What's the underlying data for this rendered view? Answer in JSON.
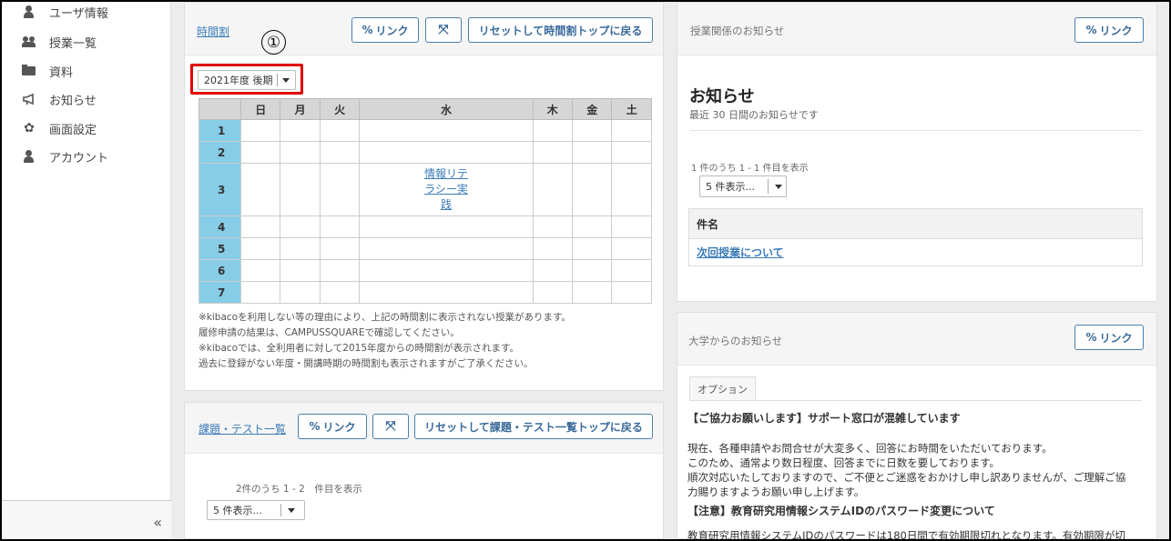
{
  "sidebar": {
    "items": [
      {
        "label": "ユーザ情報",
        "icon": "user-icon"
      },
      {
        "label": "授業一覧",
        "icon": "people-icon"
      },
      {
        "label": "資料",
        "icon": "folder-icon"
      },
      {
        "label": "お知らせ",
        "icon": "megaphone-icon"
      },
      {
        "label": "画面設定",
        "icon": "gear-icon"
      },
      {
        "label": "アカウント",
        "icon": "user-icon"
      }
    ],
    "collapse": "«"
  },
  "timetable": {
    "title": "時間割",
    "link_btn": "リンク",
    "expand_btn": "⤧",
    "reset_btn": "リセットして時間割トップに戻る",
    "term_select": "2021年度 後期",
    "annotation": "①",
    "days": [
      "日",
      "月",
      "火",
      "水",
      "木",
      "金",
      "土"
    ],
    "periods": [
      "1",
      "2",
      "3",
      "4",
      "5",
      "6",
      "7"
    ],
    "course": "情報リテラシー実践",
    "notes": [
      "※kibacoを利用しない等の理由により、上記の時間割に表示されない授業があります。",
      "履修申請の結果は、CAMPUSSQUAREで確認してください。",
      "※kibacoでは、全利用者に対して2015年度からの時間割が表示されます。",
      "過去に登録がない年度・開講時期の時間割も表示されますがご了承ください。"
    ]
  },
  "assignments": {
    "title": "課題・テスト一覧",
    "link_btn": "リンク",
    "expand_btn": "⤧",
    "reset_btn": "リセットして課題・テスト一覧トップに戻る",
    "count_text": "2件のうち 1 - 2　件目を表示",
    "page_select": "5 件表示..."
  },
  "class_notices": {
    "title": "授業関係のお知らせ",
    "link_btn": "リンク",
    "heading": "お知らせ",
    "subtitle": "最近 30 日間のお知らせです",
    "count_text": "1 件のうち 1 - 1 件目を表示",
    "page_select": "5 件表示...",
    "column": "件名",
    "rows": [
      "次回授業について"
    ]
  },
  "univ_notices": {
    "title": "大学からのお知らせ",
    "link_btn": "リンク",
    "option_tab": "オプション",
    "headline1": "【ご協力お願いします】サポート窓口が混雑しています",
    "body": [
      "現在、各種申請やお問合せが大変多く、回答にお時間をいただいております。",
      "このため、通常より数日程度、回答までに日数を要しております。",
      "順次対応いたしておりますので、ご不便とご迷惑をおかけし申し訳ありませんが、ご理解ご協",
      "力賜りますようお願い申し上げます。"
    ],
    "headline2": "【注意】教育研究用情報システムIDのパスワード変更について",
    "body2": "教育研究用情報システムIDのパスワードは180日間で有効期限切れとなります。有効期限が切"
  },
  "colors": {
    "accent": "#3a7bb8",
    "period_bg": "#87cde8",
    "highlight": "#e00000"
  }
}
